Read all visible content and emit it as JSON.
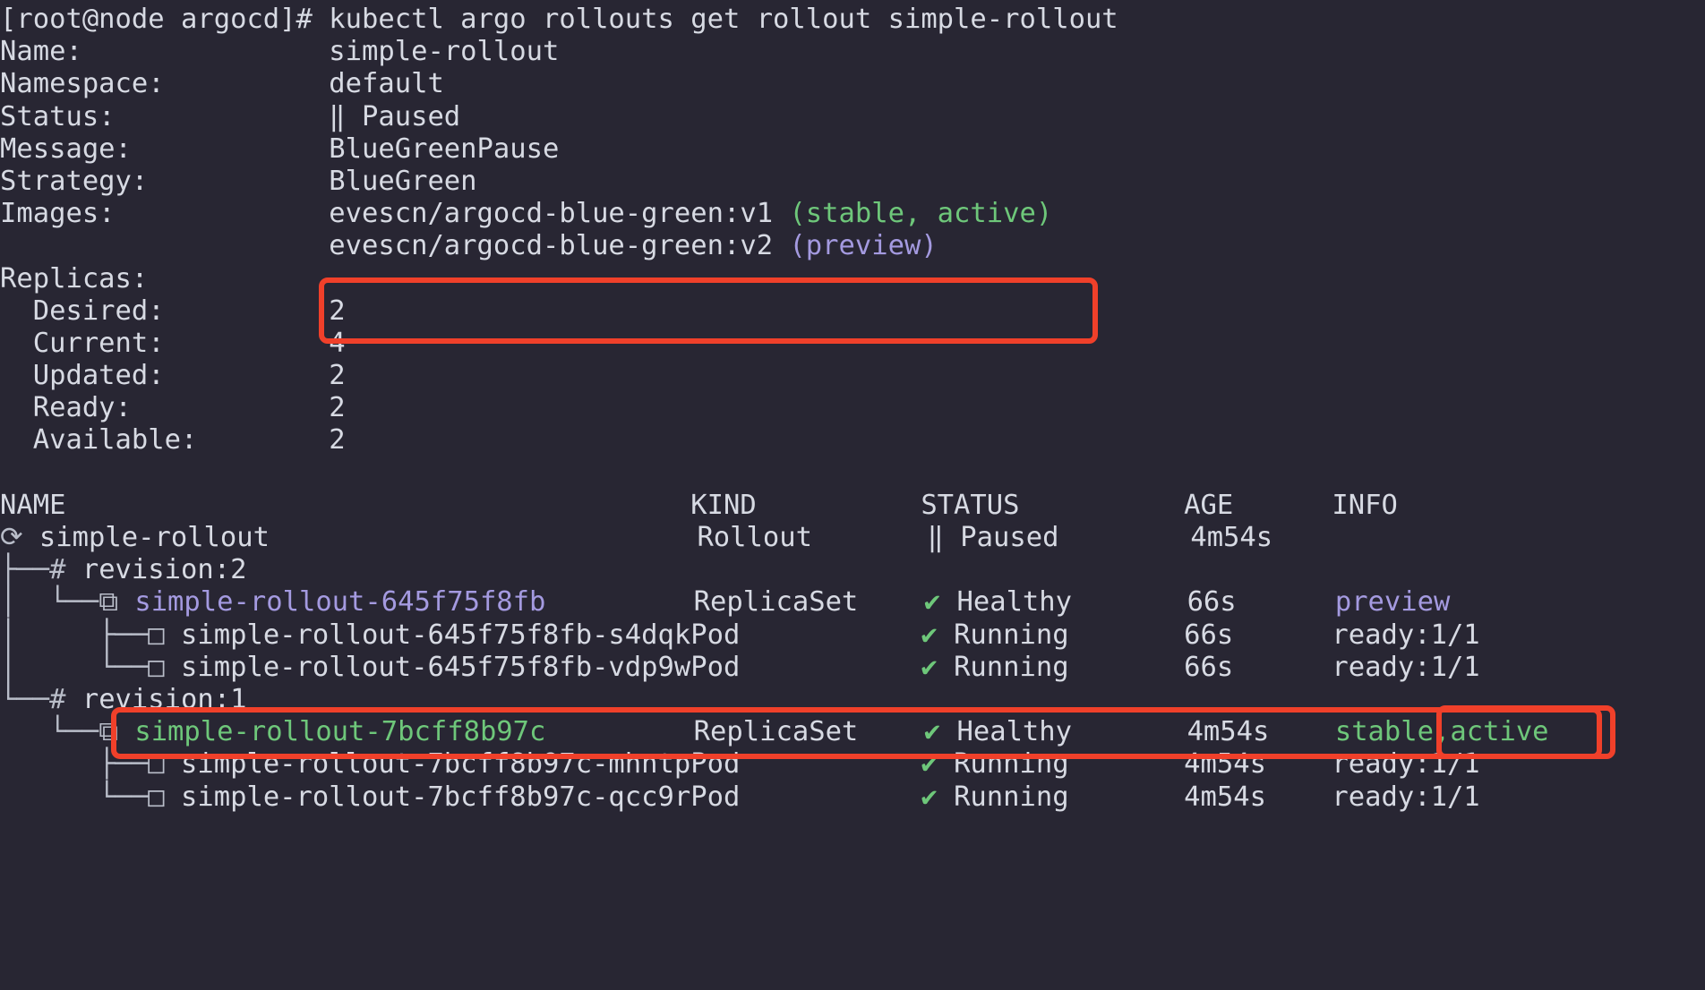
{
  "terminal": {
    "background_color": "#282633",
    "foreground_color": "#d7dae3",
    "accent_green": "#6ec77a",
    "accent_purple": "#a49ae0",
    "annotation_red": "#f0402a",
    "prompt": "[root@node argocd]#",
    "command": "kubectl argo rollouts get rollout simple-rollout"
  },
  "summary": {
    "rows": [
      {
        "label": "Name:",
        "value": "simple-rollout"
      },
      {
        "label": "Namespace:",
        "value": "default"
      },
      {
        "label": "Status:",
        "value": "Paused",
        "icon": "pause-icon",
        "icon_glyph": "‖"
      },
      {
        "label": "Message:",
        "value": "BlueGreenPause"
      },
      {
        "label": "Strategy:",
        "value": "BlueGreen"
      }
    ],
    "images_label": "Images:",
    "images": [
      {
        "name": "evescn/argocd-blue-green:v1",
        "tags": "(stable, active)",
        "tag_color": "green"
      },
      {
        "name": "evescn/argocd-blue-green:v2",
        "tags": "(preview)",
        "tag_color": "purple"
      }
    ],
    "replicas_label": "Replicas:",
    "replicas": [
      {
        "label": "Desired:",
        "value": "2"
      },
      {
        "label": "Current:",
        "value": "4"
      },
      {
        "label": "Updated:",
        "value": "2"
      },
      {
        "label": "Ready:",
        "value": "2"
      },
      {
        "label": "Available:",
        "value": "2"
      }
    ]
  },
  "tree_table": {
    "headers": {
      "name": "NAME",
      "kind": "KIND",
      "status": "STATUS",
      "age": "AGE",
      "info": "INFO"
    },
    "rows": [
      {
        "tree": "",
        "icon": "rollout-icon",
        "icon_glyph": "⟳",
        "name": "simple-rollout",
        "name_color": "fg",
        "kind": "Rollout",
        "status_icon_glyph": "‖",
        "status_icon_color": "fg",
        "status": "Paused",
        "age": "4m54s",
        "info": "",
        "info_color": "fg"
      },
      {
        "tree": "├──",
        "icon": "revision-hash-icon",
        "icon_glyph": "#",
        "name": "revision:2",
        "name_color": "fg",
        "kind": "",
        "status_icon_glyph": "",
        "status_icon_color": "fg",
        "status": "",
        "age": "",
        "info": "",
        "info_color": "fg"
      },
      {
        "tree": "│  └──",
        "icon": "replicaset-icon",
        "icon_glyph": "⧉",
        "name": "simple-rollout-645f75f8fb",
        "name_color": "purple",
        "kind": "ReplicaSet",
        "status_icon_glyph": "✔",
        "status_icon_color": "green",
        "status": "Healthy",
        "age": "66s",
        "info": "preview",
        "info_color": "purple"
      },
      {
        "tree": "│     ├──",
        "icon": "pod-icon",
        "icon_glyph": "□",
        "name": "simple-rollout-645f75f8fb-s4dqk",
        "name_color": "fg",
        "kind": "Pod",
        "status_icon_glyph": "✔",
        "status_icon_color": "green",
        "status": "Running",
        "age": "66s",
        "info": "ready:1/1",
        "info_color": "fg"
      },
      {
        "tree": "│     └──",
        "icon": "pod-icon",
        "icon_glyph": "□",
        "name": "simple-rollout-645f75f8fb-vdp9w",
        "name_color": "fg",
        "kind": "Pod",
        "status_icon_glyph": "✔",
        "status_icon_color": "green",
        "status": "Running",
        "age": "66s",
        "info": "ready:1/1",
        "info_color": "fg"
      },
      {
        "tree": "└──",
        "icon": "revision-hash-icon",
        "icon_glyph": "#",
        "name": "revision:1",
        "name_color": "fg",
        "kind": "",
        "status_icon_glyph": "",
        "status_icon_color": "fg",
        "status": "",
        "age": "",
        "info": "",
        "info_color": "fg"
      },
      {
        "tree": "   └──",
        "icon": "replicaset-icon",
        "icon_glyph": "⧉",
        "name": "simple-rollout-7bcff8b97c",
        "name_color": "green",
        "kind": "ReplicaSet",
        "status_icon_glyph": "✔",
        "status_icon_color": "green",
        "status": "Healthy",
        "age": "4m54s",
        "info": "stable,active",
        "info_color": "green"
      },
      {
        "tree": "      ├──",
        "icon": "pod-icon",
        "icon_glyph": "□",
        "name": "simple-rollout-7bcff8b97c-mhntp",
        "name_color": "fg",
        "kind": "Pod",
        "status_icon_glyph": "✔",
        "status_icon_color": "green",
        "status": "Running",
        "age": "4m54s",
        "info": "ready:1/1",
        "info_color": "fg"
      },
      {
        "tree": "      └──",
        "icon": "pod-icon",
        "icon_glyph": "□",
        "name": "simple-rollout-7bcff8b97c-qcc9r",
        "name_color": "fg",
        "kind": "Pod",
        "status_icon_glyph": "✔",
        "status_icon_color": "green",
        "status": "Running",
        "age": "4m54s",
        "info": "ready:1/1",
        "info_color": "fg"
      }
    ]
  },
  "annotations": [
    {
      "name": "highlight-preview-image",
      "target": "evescn/argocd-blue-green:v2 (preview)"
    },
    {
      "name": "highlight-preview-rs-row",
      "target": "simple-rollout-645f75f8fb ReplicaSet Healthy 66s"
    },
    {
      "name": "highlight-preview-info",
      "target": "preview"
    }
  ]
}
